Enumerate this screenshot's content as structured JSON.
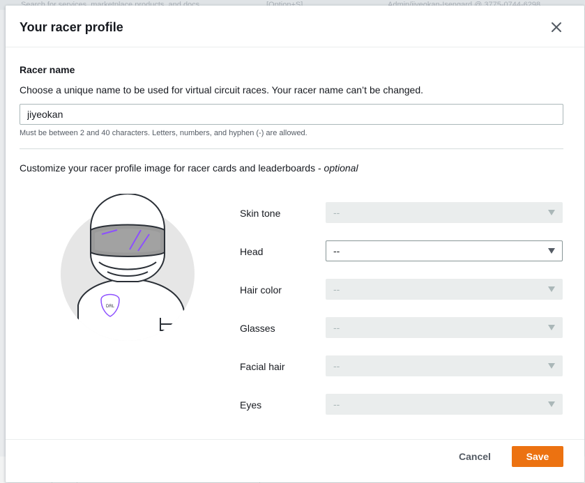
{
  "background": {
    "top_text_left": "Search for services, marketplace products, and docs",
    "top_shortcut": "[Option+S]",
    "top_account": "Admin/jiyeokan-Isengard @ 3775-0744-6298"
  },
  "modal": {
    "title": "Your racer profile",
    "close_icon": "close-icon"
  },
  "racer_name": {
    "title": "Racer name",
    "description": "Choose a unique name to be used for virtual circuit races. Your racer name can’t be changed.",
    "value": "jiyeokan",
    "constraint": "Must be between 2 and 40 characters. Letters, numbers, and hyphen (-) are allowed."
  },
  "customize": {
    "label": "Customize your racer profile image for racer cards and leaderboards - ",
    "optional": "optional",
    "avatar_badge": "DRL"
  },
  "fields": [
    {
      "label": "Skin tone",
      "value": "--",
      "enabled": false
    },
    {
      "label": "Head",
      "value": "--",
      "enabled": true
    },
    {
      "label": "Hair color",
      "value": "--",
      "enabled": false
    },
    {
      "label": "Glasses",
      "value": "--",
      "enabled": false
    },
    {
      "label": "Facial hair",
      "value": "--",
      "enabled": false
    },
    {
      "label": "Eyes",
      "value": "--",
      "enabled": false
    }
  ],
  "footer": {
    "cancel_label": "Cancel",
    "save_label": "Save"
  },
  "colors": {
    "primary_button": "#ec7211",
    "visor_stripes": "#8c4fff"
  }
}
